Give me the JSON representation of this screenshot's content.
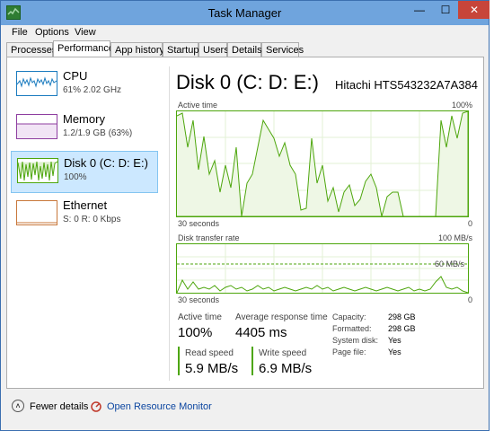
{
  "window": {
    "title": "Task Manager",
    "min": "—",
    "max": "☐",
    "close": "✕"
  },
  "menu": [
    "File",
    "Options",
    "View"
  ],
  "tabs": [
    "Processes",
    "Performance",
    "App history",
    "Startup",
    "Users",
    "Details",
    "Services"
  ],
  "active_tab": "Performance",
  "sidebar": [
    {
      "name": "CPU",
      "sub": "61% 2.02 GHz",
      "color": "#1a7bbf"
    },
    {
      "name": "Memory",
      "sub": "1.2/1.9 GB (63%)",
      "color": "#8e3ea0"
    },
    {
      "name": "Disk 0 (C: D: E:)",
      "sub": "100%",
      "color": "#4da60c",
      "selected": true
    },
    {
      "name": "Ethernet",
      "sub": "S: 0 R: 0 Kbps",
      "color": "#c8773a"
    }
  ],
  "main": {
    "title": "Disk 0 (C: D: E:)",
    "model": "Hitachi HTS543232A7A384",
    "graph1": {
      "label": "Active time",
      "max": "100%",
      "time": "30 seconds",
      "min": "0"
    },
    "graph2": {
      "label": "Disk transfer rate",
      "max": "100 MB/s",
      "mid": "60 MB/s",
      "time": "30 seconds",
      "min": "0"
    },
    "active_time": {
      "label": "Active time",
      "value": "100%"
    },
    "avg_response": {
      "label": "Average response time",
      "value": "4405 ms"
    },
    "read_speed": {
      "label": "Read speed",
      "value": "5.9 MB/s"
    },
    "write_speed": {
      "label": "Write speed",
      "value": "6.9 MB/s"
    },
    "info": [
      {
        "label": "Capacity:",
        "value": "298 GB"
      },
      {
        "label": "Formatted:",
        "value": "298 GB"
      },
      {
        "label": "System disk:",
        "value": "Yes"
      },
      {
        "label": "Page file:",
        "value": "Yes"
      }
    ]
  },
  "footer": {
    "fewer_details": "Fewer details",
    "open_resource_monitor": "Open Resource Monitor"
  },
  "colors": {
    "accent_green": "#4da60c",
    "title_bar": "#6fa4dd",
    "selection": "#cce8ff"
  }
}
